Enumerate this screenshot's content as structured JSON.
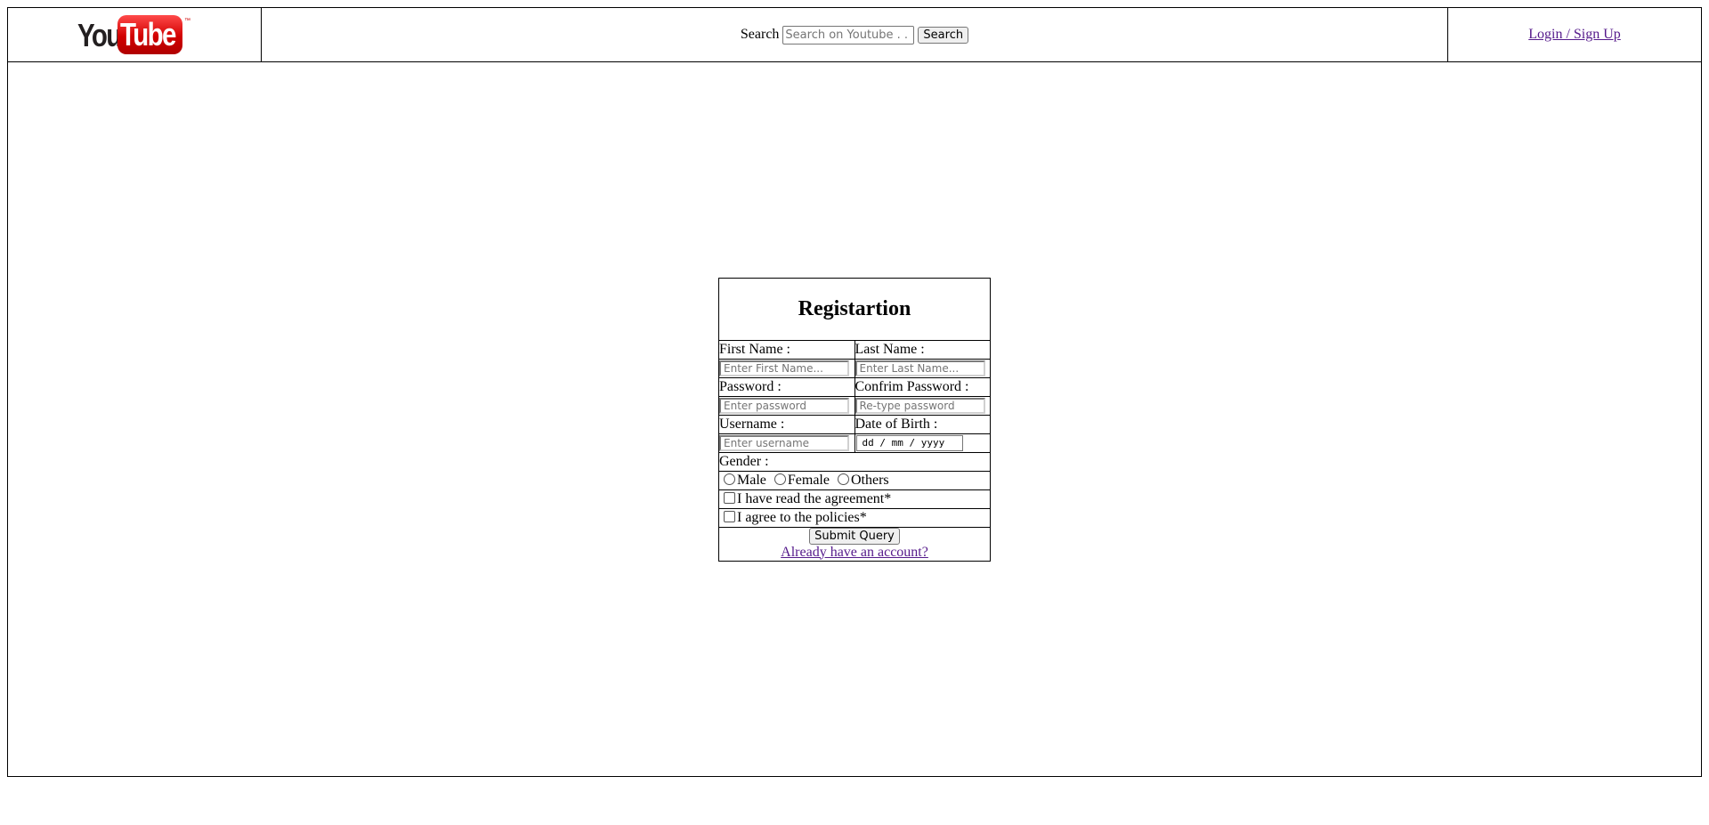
{
  "header": {
    "logo": {
      "part1": "You",
      "part2": "Tube",
      "tm": "™"
    },
    "search": {
      "label": "Search",
      "placeholder": "Search on Youtube . . .",
      "button": "Search"
    },
    "login_link": "Login / Sign Up"
  },
  "form": {
    "title": "Registartion",
    "first_name_label": "First Name :",
    "last_name_label": "Last Name :",
    "first_name_placeholder": "Enter First Name...",
    "last_name_placeholder": "Enter Last Name...",
    "password_label": "Password :",
    "confirm_password_label": "Confrim Password :",
    "password_placeholder": "Enter password",
    "confirm_password_placeholder": "Re-type password",
    "username_label": "Username :",
    "dob_label": "Date of Birth :",
    "username_placeholder": "Enter username",
    "dob_placeholder": "dd / mm / yyyy",
    "gender_label": "Gender :",
    "gender_options": [
      "Male",
      "Female",
      "Others"
    ],
    "agreement_label": "I have read the agreement*",
    "policies_label": "I agree to the policies*",
    "submit": "Submit Query",
    "account_link": "Already have an account?"
  },
  "colors": {
    "link": "#551a8b",
    "logo_red": "#d10000"
  }
}
